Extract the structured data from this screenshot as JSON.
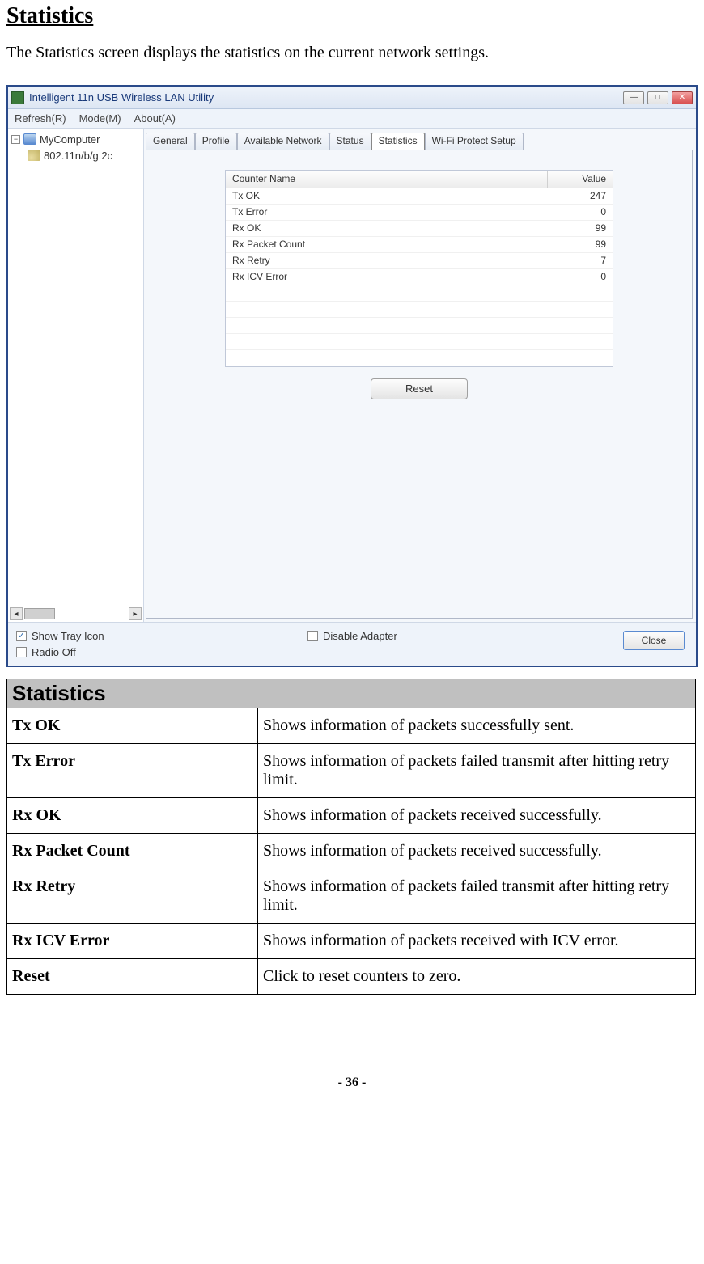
{
  "page": {
    "heading": "Statistics",
    "description": "The Statistics screen displays the statistics on the current network settings.",
    "page_number": "- 36 -"
  },
  "window": {
    "title": "Intelligent 11n USB Wireless LAN Utility",
    "menu": {
      "refresh": "Refresh(R)",
      "mode": "Mode(M)",
      "about": "About(A)"
    },
    "tree": {
      "root": "MyComputer",
      "child": "802.11n/b/g 2c",
      "expander": "−",
      "scroll_thumb_label": "…"
    },
    "tabs": [
      "General",
      "Profile",
      "Available Network",
      "Status",
      "Statistics",
      "Wi-Fi Protect Setup"
    ],
    "active_tab": "Statistics",
    "stats_header": {
      "col1": "Counter Name",
      "col2": "Value"
    },
    "stats_rows": [
      {
        "name": "Tx OK",
        "value": "247"
      },
      {
        "name": "Tx Error",
        "value": "0"
      },
      {
        "name": "Rx OK",
        "value": "99"
      },
      {
        "name": "Rx Packet Count",
        "value": "99"
      },
      {
        "name": "Rx Retry",
        "value": "7"
      },
      {
        "name": "Rx ICV Error",
        "value": "0"
      }
    ],
    "reset_label": "Reset",
    "checks": {
      "show_tray": "Show Tray Icon",
      "radio_off": "Radio Off",
      "disable_adapter": "Disable Adapter"
    },
    "close_label": "Close"
  },
  "desc_table": {
    "header": "Statistics",
    "rows": [
      {
        "label": "Tx OK",
        "desc": "Shows information of packets successfully sent."
      },
      {
        "label": "Tx Error",
        "desc": "Shows information of packets failed transmit after hitting retry limit."
      },
      {
        "label": "Rx OK",
        "desc": "Shows information of packets received successfully."
      },
      {
        "label": "Rx Packet Count",
        "desc": "Shows information of packets received successfully."
      },
      {
        "label": "Rx Retry",
        "desc": "Shows information of packets failed transmit after hitting retry limit."
      },
      {
        "label": "Rx ICV Error",
        "desc": "Shows information of packets received with ICV error."
      },
      {
        "label": "Reset",
        "desc": "Click to reset counters to zero."
      }
    ]
  }
}
